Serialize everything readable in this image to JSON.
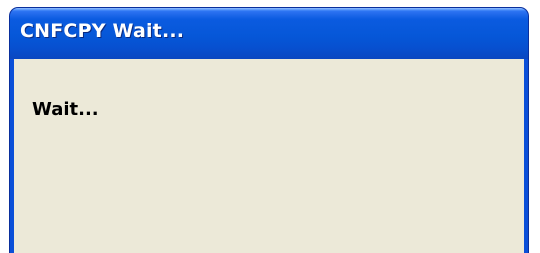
{
  "window": {
    "title": "CNFCPY Wait...",
    "titlebar_color": "#0657d8",
    "client_background": "#ece9d8"
  },
  "dialog": {
    "message": "Wait..."
  }
}
